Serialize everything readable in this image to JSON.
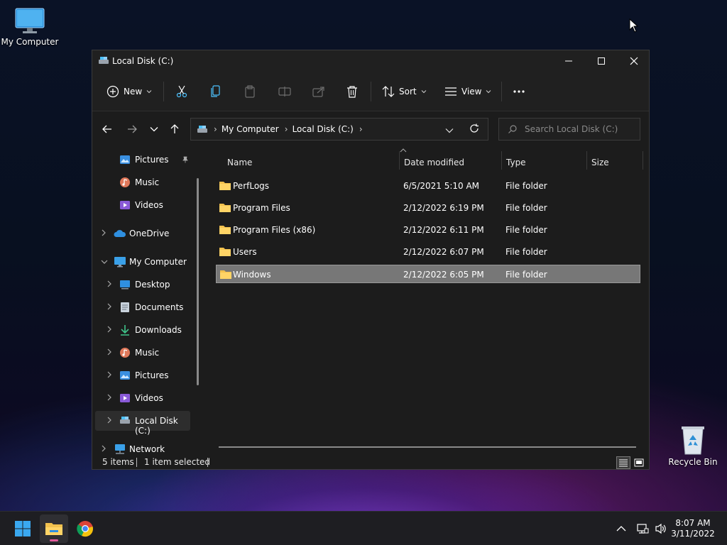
{
  "desktop": {
    "my_computer_label": "My Computer",
    "recycle_bin_label": "Recycle Bin"
  },
  "window": {
    "title": "Local Disk (C:)",
    "toolbar": {
      "new_label": "New",
      "sort_label": "Sort",
      "view_label": "View"
    },
    "address": {
      "crumbs": [
        "My Computer",
        "Local Disk (C:)"
      ]
    },
    "search": {
      "placeholder": "Search Local Disk (C:)"
    },
    "nav": {
      "items": [
        {
          "label": "Pictures",
          "icon": "pictures-icon"
        },
        {
          "label": "Music",
          "icon": "music-icon"
        },
        {
          "label": "Videos",
          "icon": "videos-icon"
        },
        {
          "label": "OneDrive",
          "icon": "onedrive-icon"
        },
        {
          "label": "My Computer",
          "icon": "computer-icon"
        },
        {
          "label": "Desktop",
          "icon": "desktop-icon"
        },
        {
          "label": "Documents",
          "icon": "documents-icon"
        },
        {
          "label": "Downloads",
          "icon": "downloads-icon"
        },
        {
          "label": "Music",
          "icon": "music-icon"
        },
        {
          "label": "Pictures",
          "icon": "pictures-icon"
        },
        {
          "label": "Videos",
          "icon": "videos-icon"
        },
        {
          "label": "Local Disk (C:)",
          "icon": "drive-icon"
        },
        {
          "label": "Network",
          "icon": "network-icon"
        }
      ]
    },
    "columns": {
      "name": "Name",
      "date": "Date modified",
      "type": "Type",
      "size": "Size"
    },
    "files": [
      {
        "name": "PerfLogs",
        "date": "6/5/2021 5:10 AM",
        "type": "File folder",
        "size": ""
      },
      {
        "name": "Program Files",
        "date": "2/12/2022 6:19 PM",
        "type": "File folder",
        "size": ""
      },
      {
        "name": "Program Files (x86)",
        "date": "2/12/2022 6:11 PM",
        "type": "File folder",
        "size": ""
      },
      {
        "name": "Users",
        "date": "2/12/2022 6:07 PM",
        "type": "File folder",
        "size": ""
      },
      {
        "name": "Windows",
        "date": "2/12/2022 6:05 PM",
        "type": "File folder",
        "size": ""
      }
    ],
    "status": {
      "item_count": "5 items",
      "selection": "1 item selected"
    }
  },
  "taskbar": {
    "time": "8:07 AM",
    "date": "3/11/2022"
  },
  "colors": {
    "folder": "#f2c14e",
    "selection": "#777777",
    "accent": "#4cc2ff"
  }
}
